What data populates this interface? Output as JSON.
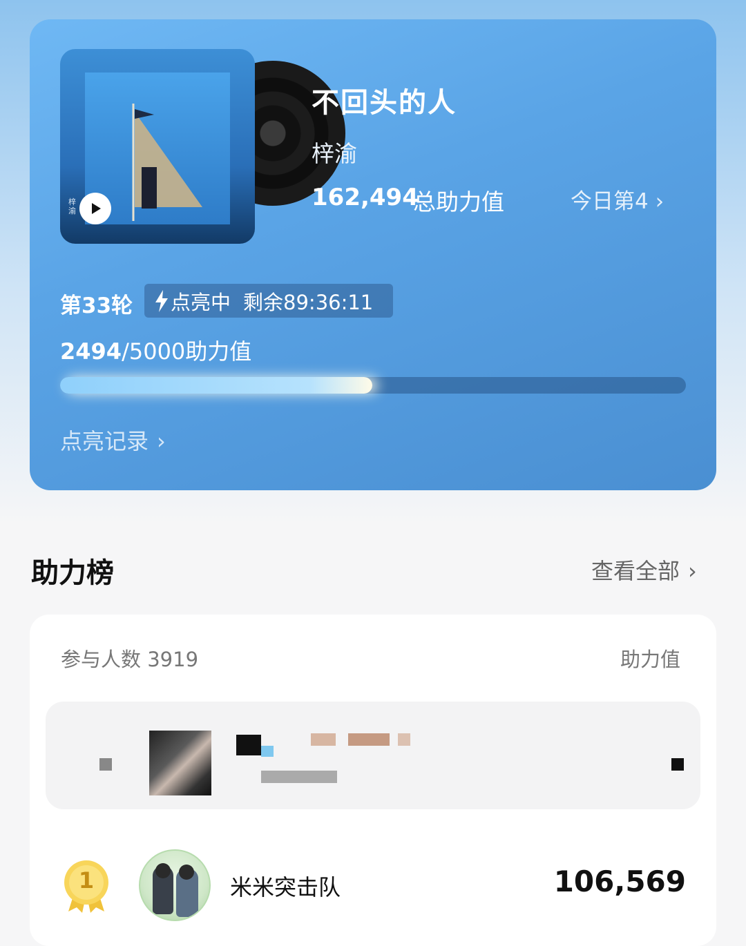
{
  "song": {
    "title": "不回头的人",
    "artist": "梓渝",
    "cover_artist_text": "梓渝",
    "total_boost_value": "162,494",
    "total_boost_label": "总助力值",
    "today_rank": "今日第4",
    "play_icon": "play-icon"
  },
  "round": {
    "label": "第33轮",
    "status": "点亮中",
    "remaining": "剩余89:36:11",
    "progress_current": "2494",
    "progress_total": "/5000助力值",
    "progress_fraction": 0.4988,
    "history_link": "点亮记录"
  },
  "leaderboard": {
    "title": "助力榜",
    "view_all": "查看全部",
    "participants": "参与人数 3919",
    "value_header": "助力值",
    "entries": [
      {
        "rank": "1",
        "name": "米米突击队",
        "value": "106,569"
      }
    ]
  },
  "colors": {
    "hero_top": "#6fb8f4",
    "hero_bottom": "#4a8fd2",
    "medal_gold": "#f4c430"
  }
}
